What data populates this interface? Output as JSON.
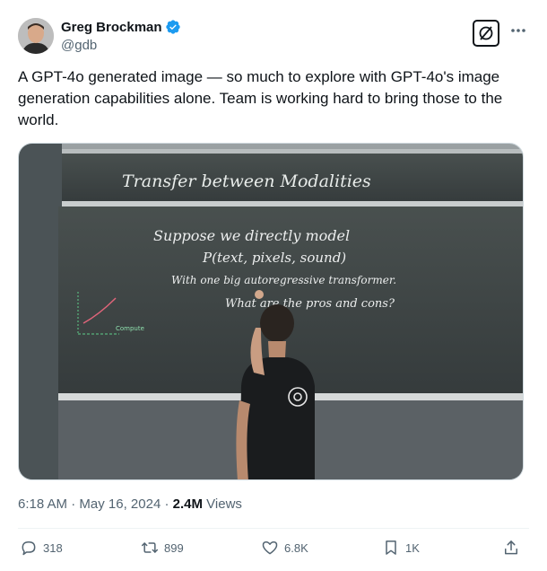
{
  "author": {
    "display_name": "Greg Brockman",
    "handle": "@gdb",
    "verified": true
  },
  "icons": {
    "verified": "verified-badge-icon",
    "grok": "grok-icon",
    "more": "more-icon",
    "reply": "reply-icon",
    "retweet": "retweet-icon",
    "like": "like-icon",
    "bookmark": "bookmark-icon",
    "share": "share-icon"
  },
  "tweet": {
    "text": "A GPT-4o generated image — so much to explore with GPT-4o's image generation capabilities alone. Team is working hard to bring those to the world."
  },
  "media": {
    "board_title": "Transfer between Modalities",
    "lines": [
      "Suppose we directly model",
      "P(text, pixels, sound)",
      "With one big autoregressive transformer.",
      "What are the pros and cons?"
    ],
    "graph_label": "Compute"
  },
  "meta": {
    "time": "6:18 AM",
    "separator": "·",
    "date": "May 16, 2024",
    "views_count": "2.4M",
    "views_label": "Views"
  },
  "actions": {
    "replies": "318",
    "reposts": "899",
    "likes": "6.8K",
    "bookmarks": "1K"
  },
  "colors": {
    "verified": "#1d9bf0",
    "text": "#0f1419",
    "secondary": "#536471",
    "chalkboard": "#3c4447"
  }
}
